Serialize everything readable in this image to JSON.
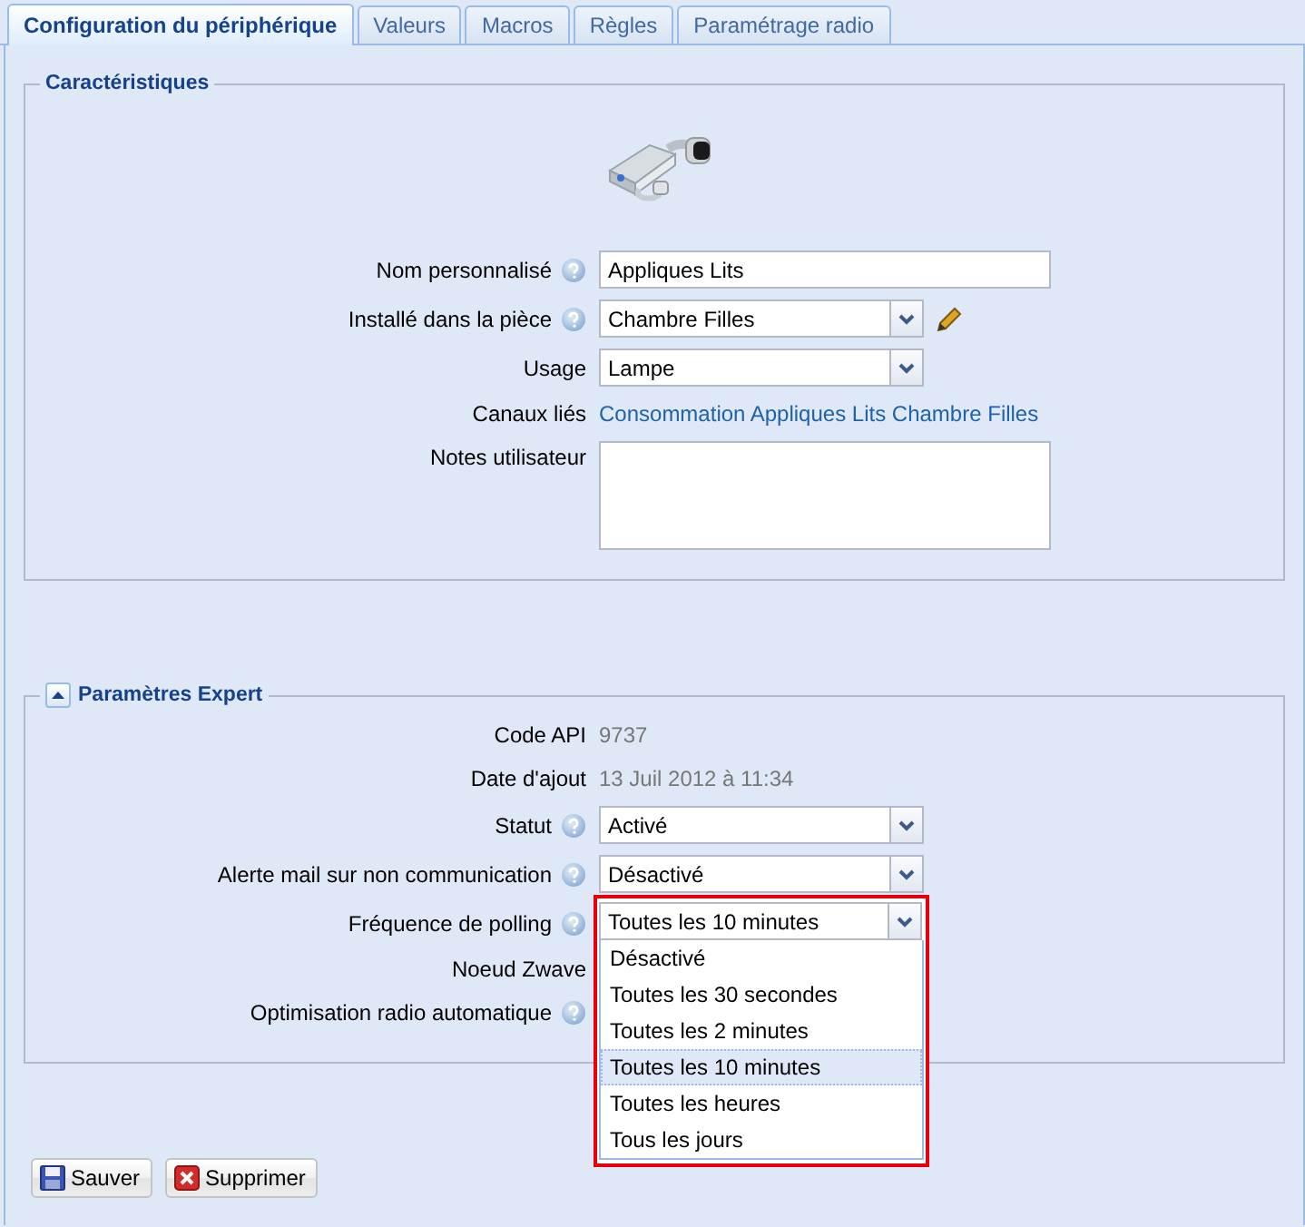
{
  "tabs": [
    {
      "label": "Configuration du périphérique",
      "selected": true
    },
    {
      "label": "Valeurs",
      "selected": false
    },
    {
      "label": "Macros",
      "selected": false
    },
    {
      "label": "Règles",
      "selected": false
    },
    {
      "label": "Paramétrage radio",
      "selected": false
    }
  ],
  "characteristics": {
    "title": "Caractéristiques",
    "fields": [
      {
        "label": "Nom personnalisé",
        "help": true,
        "kind": "text",
        "value": "Appliques Lits"
      },
      {
        "label": "Installé dans la pièce",
        "help": true,
        "kind": "select",
        "value": "Chambre Filles",
        "editable": true
      },
      {
        "label": "Usage",
        "help": false,
        "kind": "select",
        "value": "Lampe"
      },
      {
        "label": "Canaux liés",
        "help": false,
        "kind": "link",
        "value": "Consommation Appliques Lits Chambre Filles"
      },
      {
        "label": "Notes utilisateur",
        "help": false,
        "kind": "textarea"
      }
    ]
  },
  "expert": {
    "title": "Paramètres Expert",
    "expanded": true,
    "fields": [
      {
        "label": "Code API",
        "help": false,
        "kind": "static",
        "value": "9737"
      },
      {
        "label": "Date d'ajout",
        "help": false,
        "kind": "static",
        "value": "13 Juil 2012 à 11:34"
      },
      {
        "label": "Statut",
        "help": true,
        "kind": "select",
        "value": "Activé"
      },
      {
        "label": "Alerte mail sur non communication",
        "help": true,
        "kind": "select",
        "value": "Désactivé"
      },
      {
        "label": "Fréquence de polling",
        "help": true,
        "kind": "select",
        "value": "Toutes les 10 minutes",
        "open": true,
        "options": [
          {
            "label": "Désactivé",
            "selected": false
          },
          {
            "label": "Toutes les 30 secondes",
            "selected": false
          },
          {
            "label": "Toutes les 2 minutes",
            "selected": false
          },
          {
            "label": "Toutes les 10 minutes",
            "selected": true
          },
          {
            "label": "Toutes les heures",
            "selected": false
          },
          {
            "label": "Tous les jours",
            "selected": false
          }
        ]
      },
      {
        "label": "Noeud Zwave",
        "help": false,
        "kind": "label"
      },
      {
        "label": "Optimisation radio automatique",
        "help": true,
        "kind": "label"
      }
    ]
  },
  "buttons": [
    {
      "label": "Sauver",
      "kind": "save"
    },
    {
      "label": "Supprimer",
      "kind": "delete"
    }
  ]
}
